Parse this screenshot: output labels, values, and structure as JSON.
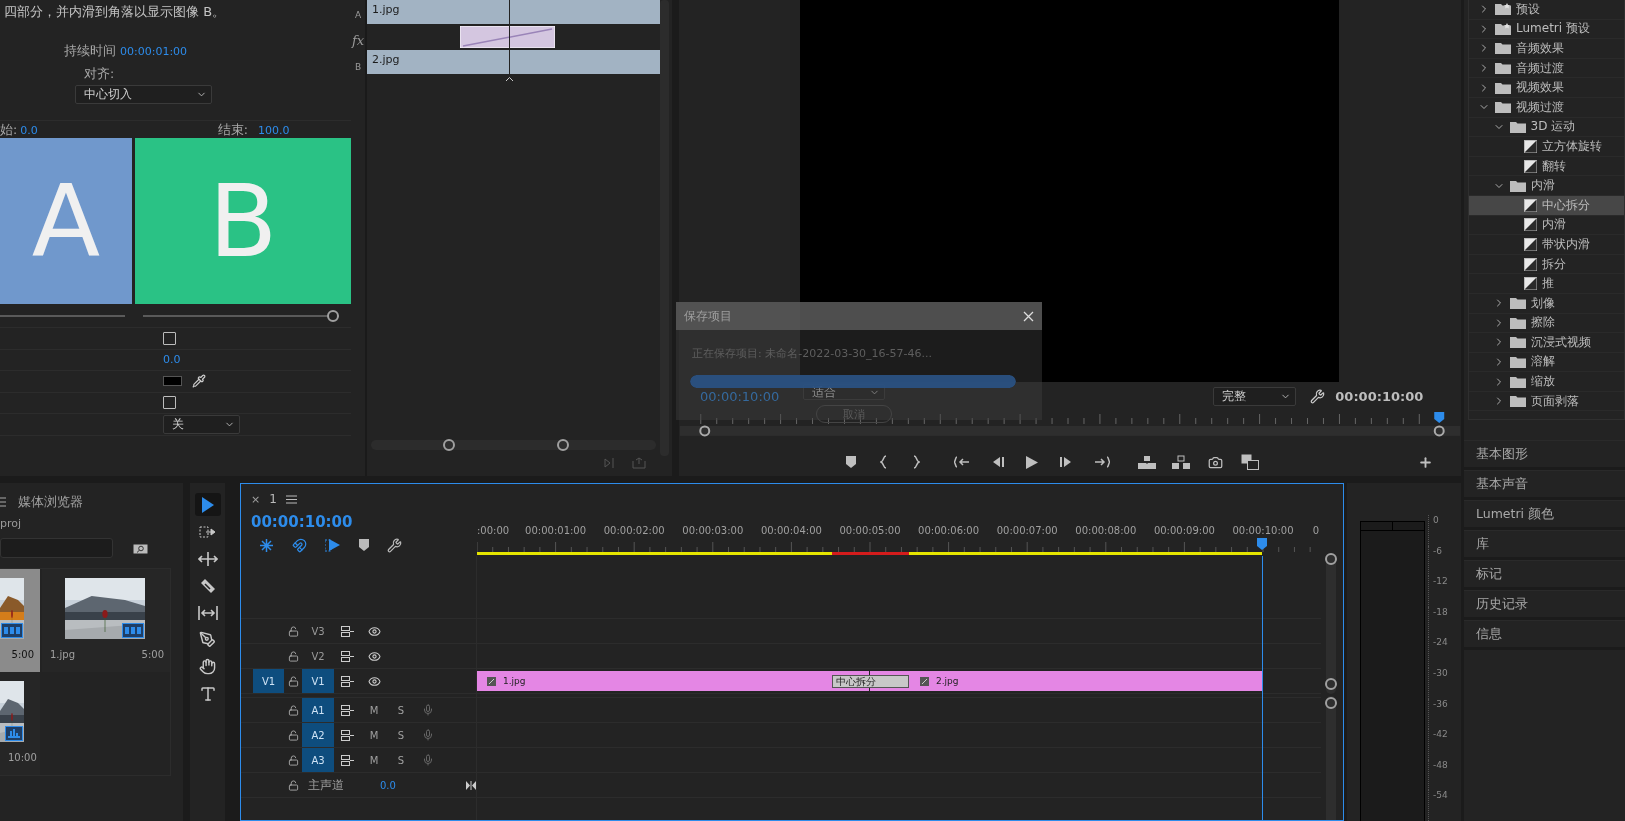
{
  "effect_controls": {
    "description": "四部分，并内滑到角落以显示图像 B。",
    "duration_label": "持续时间",
    "duration": "00:00:01:00",
    "align_label": "对齐:",
    "align_value": "中心切入",
    "start_label": "始:",
    "start_value": "0.0",
    "end_label": "结束:",
    "end_value": "100.0",
    "preview_a": "A",
    "preview_b": "B",
    "end_slider": {
      "level": 1
    },
    "properties": [
      {
        "kind": "checkbox",
        "checked": false
      },
      {
        "kind": "number",
        "value": "0.0"
      },
      {
        "kind": "color",
        "color": "#000000"
      },
      {
        "kind": "checkbox",
        "checked": false
      },
      {
        "kind": "dropdown",
        "value": "关"
      }
    ]
  },
  "transition_timeline": {
    "track_a_label": "A",
    "fx_label": "fx",
    "track_b_label": "B",
    "clip_a": "1.jpg",
    "clip_b": "2.jpg"
  },
  "monitor": {
    "timecode": "00:00:10:00",
    "zoom": "适合",
    "quality": "完整",
    "duration": "00:00:10:00"
  },
  "save_dialog": {
    "title": "保存项目",
    "message": "正在保存项目: 未命名-2022-03-30_16-57-46...",
    "progress": {
      "level": 1
    },
    "cancel": "取消"
  },
  "effects_tree": [
    {
      "label": "预设",
      "kind": "preset-folder",
      "expanded": false,
      "selected": false
    },
    {
      "label": "Lumetri 预设",
      "kind": "preset-folder",
      "expanded": false,
      "selected": false
    },
    {
      "label": "音频效果",
      "kind": "folder",
      "expanded": false,
      "selected": false
    },
    {
      "label": "音频过渡",
      "kind": "folder",
      "expanded": false,
      "selected": false
    },
    {
      "label": "视频效果",
      "kind": "folder",
      "expanded": false,
      "selected": false
    },
    {
      "label": "视频过渡",
      "kind": "folder",
      "expanded": true,
      "selected": false,
      "children": [
        {
          "label": "3D 运动",
          "kind": "folder",
          "expanded": true,
          "selected": false,
          "children": [
            {
              "label": "立方体旋转",
              "kind": "transition",
              "selected": false
            },
            {
              "label": "翻转",
              "kind": "transition",
              "selected": false
            }
          ]
        },
        {
          "label": "内滑",
          "kind": "folder",
          "expanded": true,
          "selected": false,
          "children": [
            {
              "label": "中心拆分",
              "kind": "transition",
              "selected": true
            },
            {
              "label": "内滑",
              "kind": "transition",
              "selected": false
            },
            {
              "label": "带状内滑",
              "kind": "transition",
              "selected": false
            },
            {
              "label": "拆分",
              "kind": "transition",
              "selected": false
            },
            {
              "label": "推",
              "kind": "transition",
              "selected": false
            }
          ]
        },
        {
          "label": "划像",
          "kind": "folder",
          "expanded": false,
          "selected": false
        },
        {
          "label": "擦除",
          "kind": "folder",
          "expanded": false,
          "selected": false
        },
        {
          "label": "沉浸式视频",
          "kind": "folder",
          "expanded": false,
          "selected": false
        },
        {
          "label": "溶解",
          "kind": "folder",
          "expanded": false,
          "selected": false
        },
        {
          "label": "缩放",
          "kind": "folder",
          "expanded": false,
          "selected": false
        },
        {
          "label": "页面剥落",
          "kind": "folder",
          "expanded": false,
          "selected": false
        }
      ]
    }
  ],
  "panels": [
    "基本图形",
    "基本声音",
    "Lumetri 颜色",
    "库",
    "标记",
    "历史记录",
    "信息"
  ],
  "project": {
    "tab": "媒体浏览器",
    "path": "proj",
    "items": [
      {
        "kind": "video",
        "duration": "5:00",
        "selected": true
      },
      {
        "kind": "video",
        "name": "1.jpg",
        "duration": "5:00",
        "selected": false
      },
      {
        "kind": "sequence",
        "duration": "10:00",
        "selected": false
      }
    ]
  },
  "tools": [
    {
      "kind": "selection",
      "selected": true
    },
    {
      "kind": "track-select",
      "selected": false
    },
    {
      "kind": "ripple",
      "selected": false
    },
    {
      "kind": "razor",
      "selected": false
    },
    {
      "kind": "slip",
      "selected": false
    },
    {
      "kind": "pen",
      "selected": false
    },
    {
      "kind": "hand",
      "selected": false
    },
    {
      "kind": "type",
      "selected": false
    }
  ],
  "timeline": {
    "close": "×",
    "tab": "1",
    "timecode": "00:00:10:00",
    "ruler": [
      ":00:00",
      "00:00:01:00",
      "00:00:02:00",
      "00:00:03:00",
      "00:00:04:00",
      "00:00:05:00",
      "00:00:06:00",
      "00:00:07:00",
      "00:00:08:00",
      "00:00:09:00",
      "00:00:10:00",
      "0"
    ],
    "video_tracks": [
      {
        "name": "V3",
        "targeted": false
      },
      {
        "name": "V2",
        "targeted": false
      },
      {
        "name": "V1",
        "targeted": true,
        "source": "V1",
        "clips": [
          "1.jpg",
          "2.jpg"
        ],
        "transition": "中心拆分"
      }
    ],
    "audio_tracks": [
      {
        "name": "A1",
        "targeted": true,
        "mute": "M",
        "solo": "S"
      },
      {
        "name": "A2",
        "targeted": true,
        "mute": "M",
        "solo": "S"
      },
      {
        "name": "A3",
        "targeted": true,
        "mute": "M",
        "solo": "S"
      }
    ],
    "master": {
      "name": "主声道",
      "value": "0.0"
    }
  },
  "meter_scale": [
    "0",
    "-6",
    "-12",
    "-18",
    "-24",
    "-30",
    "-36",
    "-42",
    "-48",
    "-54"
  ]
}
